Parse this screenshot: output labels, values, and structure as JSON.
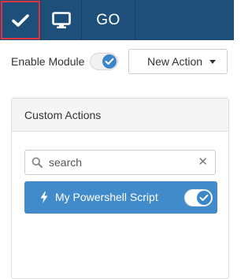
{
  "topbar": {
    "tabs": [
      {
        "icon": "check-icon",
        "active": true
      },
      {
        "icon": "monitor-icon",
        "active": false
      },
      {
        "label": "GO",
        "active": false
      }
    ],
    "background": "#1d4f7a",
    "active_outline": "#e0343e"
  },
  "module": {
    "enable_label": "Enable Module",
    "enabled": true
  },
  "new_action": {
    "label": "New Action"
  },
  "custom_actions": {
    "title": "Custom Actions",
    "search": {
      "placeholder": "search",
      "value": ""
    },
    "items": [
      {
        "label": "My Powershell Script",
        "icon": "bolt-icon",
        "enabled": true
      }
    ]
  },
  "colors": {
    "accent": "#428bca",
    "toggle_knob": "#3b86c6"
  }
}
